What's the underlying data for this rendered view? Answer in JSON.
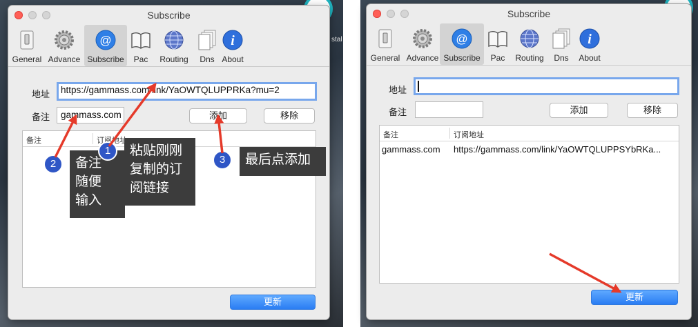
{
  "left": {
    "title": "Subscribe",
    "toolbar": [
      {
        "label": "General",
        "icon": "switch-icon"
      },
      {
        "label": "Advance",
        "icon": "gear-icon"
      },
      {
        "label": "Subscribe",
        "icon": "at-sign-icon"
      },
      {
        "label": "Pac",
        "icon": "book-icon"
      },
      {
        "label": "Routing",
        "icon": "globe-icon"
      },
      {
        "label": "Dns",
        "icon": "document-icon"
      },
      {
        "label": "About",
        "icon": "info-icon"
      }
    ],
    "address_label": "地址",
    "address_value": "https://gammass.com/link/YaOWTQLUPPRKa?mu=2",
    "remark_label": "备注",
    "remark_value": "gammass.com",
    "add_button": "添加",
    "remove_button": "移除",
    "columns": [
      "备注",
      "订阅地址"
    ],
    "update_button": "更新",
    "annotations": [
      {
        "number": "1",
        "text_lines": [
          "粘贴刚刚",
          "复制的订",
          "阅链接"
        ]
      },
      {
        "number": "2",
        "text_lines": [
          "备注",
          "随便",
          "输入"
        ]
      },
      {
        "number": "3",
        "text_lines": [
          "最后点添加"
        ]
      }
    ],
    "bg_partial_text": "stal"
  },
  "right": {
    "title": "Subscribe",
    "toolbar": [
      {
        "label": "General",
        "icon": "switch-icon"
      },
      {
        "label": "Advance",
        "icon": "gear-icon"
      },
      {
        "label": "Subscribe",
        "icon": "at-sign-icon"
      },
      {
        "label": "Pac",
        "icon": "book-icon"
      },
      {
        "label": "Routing",
        "icon": "globe-icon"
      },
      {
        "label": "Dns",
        "icon": "document-icon"
      },
      {
        "label": "About",
        "icon": "info-icon"
      }
    ],
    "address_label": "地址",
    "address_value": "",
    "remark_label": "备注",
    "remark_value": "",
    "add_button": "添加",
    "remove_button": "移除",
    "columns": [
      "备注",
      "订阅地址"
    ],
    "rows": [
      {
        "remark": "gammass.com",
        "url": "https://gammass.com/link/YaOWTQLUPPSYbRKa..."
      }
    ],
    "update_button": "更新"
  },
  "colors": {
    "accent": "#2a7df3",
    "annotation_badge": "#2f56c6",
    "arrow": "#e53a2a",
    "tooltip": "#3c3c3c"
  }
}
